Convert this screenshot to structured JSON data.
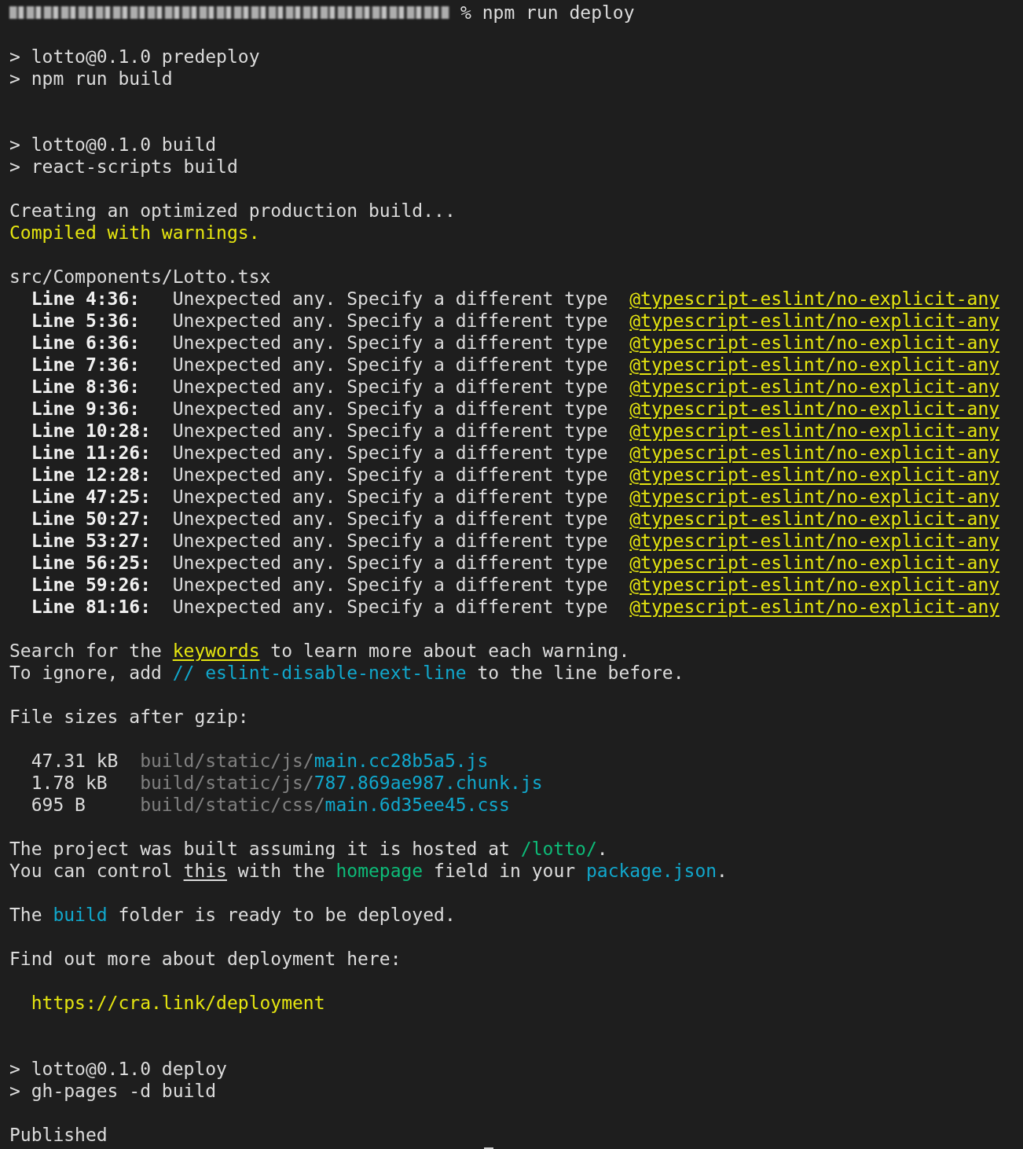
{
  "terminal": {
    "lines": [
      {
        "kind": "prompt",
        "command": "% npm run deploy",
        "cursor": false
      },
      {
        "kind": "blank"
      },
      {
        "kind": "text",
        "segments": [
          {
            "text": "> lotto@0.1.0 predeploy",
            "kind": "plain"
          }
        ]
      },
      {
        "kind": "text",
        "segments": [
          {
            "text": "> npm run build",
            "kind": "plain"
          }
        ]
      },
      {
        "kind": "blank"
      },
      {
        "kind": "blank"
      },
      {
        "kind": "text",
        "segments": [
          {
            "text": "> lotto@0.1.0 build",
            "kind": "plain"
          }
        ]
      },
      {
        "kind": "text",
        "segments": [
          {
            "text": "> react-scripts build",
            "kind": "plain"
          }
        ]
      },
      {
        "kind": "blank"
      },
      {
        "kind": "text",
        "segments": [
          {
            "text": "Creating an optimized production build...",
            "kind": "plain"
          }
        ]
      },
      {
        "kind": "text",
        "segments": [
          {
            "text": "Compiled with warnings.",
            "kind": "yellow"
          }
        ]
      },
      {
        "kind": "blank"
      },
      {
        "kind": "text",
        "segments": [
          {
            "text": "src/Components/Lotto.tsx",
            "kind": "plain"
          }
        ]
      },
      {
        "kind": "lint",
        "location": "Line 4:36:",
        "message": "Unexpected any. Specify a different type",
        "rule": "@typescript-eslint/no-explicit-any"
      },
      {
        "kind": "lint",
        "location": "Line 5:36:",
        "message": "Unexpected any. Specify a different type",
        "rule": "@typescript-eslint/no-explicit-any"
      },
      {
        "kind": "lint",
        "location": "Line 6:36:",
        "message": "Unexpected any. Specify a different type",
        "rule": "@typescript-eslint/no-explicit-any"
      },
      {
        "kind": "lint",
        "location": "Line 7:36:",
        "message": "Unexpected any. Specify a different type",
        "rule": "@typescript-eslint/no-explicit-any"
      },
      {
        "kind": "lint",
        "location": "Line 8:36:",
        "message": "Unexpected any. Specify a different type",
        "rule": "@typescript-eslint/no-explicit-any"
      },
      {
        "kind": "lint",
        "location": "Line 9:36:",
        "message": "Unexpected any. Specify a different type",
        "rule": "@typescript-eslint/no-explicit-any"
      },
      {
        "kind": "lint",
        "location": "Line 10:28:",
        "message": "Unexpected any. Specify a different type",
        "rule": "@typescript-eslint/no-explicit-any"
      },
      {
        "kind": "lint",
        "location": "Line 11:26:",
        "message": "Unexpected any. Specify a different type",
        "rule": "@typescript-eslint/no-explicit-any"
      },
      {
        "kind": "lint",
        "location": "Line 12:28:",
        "message": "Unexpected any. Specify a different type",
        "rule": "@typescript-eslint/no-explicit-any"
      },
      {
        "kind": "lint",
        "location": "Line 47:25:",
        "message": "Unexpected any. Specify a different type",
        "rule": "@typescript-eslint/no-explicit-any"
      },
      {
        "kind": "lint",
        "location": "Line 50:27:",
        "message": "Unexpected any. Specify a different type",
        "rule": "@typescript-eslint/no-explicit-any"
      },
      {
        "kind": "lint",
        "location": "Line 53:27:",
        "message": "Unexpected any. Specify a different type",
        "rule": "@typescript-eslint/no-explicit-any"
      },
      {
        "kind": "lint",
        "location": "Line 56:25:",
        "message": "Unexpected any. Specify a different type",
        "rule": "@typescript-eslint/no-explicit-any"
      },
      {
        "kind": "lint",
        "location": "Line 59:26:",
        "message": "Unexpected any. Specify a different type",
        "rule": "@typescript-eslint/no-explicit-any"
      },
      {
        "kind": "lint",
        "location": "Line 81:16:",
        "message": "Unexpected any. Specify a different type",
        "rule": "@typescript-eslint/no-explicit-any"
      },
      {
        "kind": "blank"
      },
      {
        "kind": "text",
        "segments": [
          {
            "text": "Search for the ",
            "kind": "plain"
          },
          {
            "text": "keywords",
            "kind": "yellow-underline"
          },
          {
            "text": " to learn more about each warning.",
            "kind": "plain"
          }
        ]
      },
      {
        "kind": "text",
        "segments": [
          {
            "text": "To ignore, add ",
            "kind": "plain"
          },
          {
            "text": "// eslint-disable-next-line",
            "kind": "cyan"
          },
          {
            "text": " to the line before.",
            "kind": "plain"
          }
        ]
      },
      {
        "kind": "blank"
      },
      {
        "kind": "text",
        "segments": [
          {
            "text": "File sizes after gzip:",
            "kind": "plain"
          }
        ]
      },
      {
        "kind": "blank"
      },
      {
        "kind": "file",
        "size": "47.31 kB",
        "dir": "build/static/js/",
        "name": "main.cc28b5a5.js"
      },
      {
        "kind": "file",
        "size": "1.78 kB",
        "dir": "build/static/js/",
        "name": "787.869ae987.chunk.js"
      },
      {
        "kind": "file",
        "size": "695 B",
        "dir": "build/static/css/",
        "name": "main.6d35ee45.css"
      },
      {
        "kind": "blank"
      },
      {
        "kind": "text",
        "segments": [
          {
            "text": "The project was built assuming it is hosted at ",
            "kind": "plain"
          },
          {
            "text": "/lotto/",
            "kind": "green"
          },
          {
            "text": ".",
            "kind": "plain"
          }
        ]
      },
      {
        "kind": "text",
        "segments": [
          {
            "text": "You can control ",
            "kind": "plain"
          },
          {
            "text": "this",
            "kind": "underline"
          },
          {
            "text": " with the ",
            "kind": "plain"
          },
          {
            "text": "homepage",
            "kind": "green"
          },
          {
            "text": " field in your ",
            "kind": "plain"
          },
          {
            "text": "package.json",
            "kind": "cyan"
          },
          {
            "text": ".",
            "kind": "plain"
          }
        ]
      },
      {
        "kind": "blank"
      },
      {
        "kind": "text",
        "segments": [
          {
            "text": "The ",
            "kind": "plain"
          },
          {
            "text": "build",
            "kind": "cyan"
          },
          {
            "text": " folder is ready to be deployed.",
            "kind": "plain"
          }
        ]
      },
      {
        "kind": "blank"
      },
      {
        "kind": "text",
        "segments": [
          {
            "text": "Find out more about deployment here:",
            "kind": "plain"
          }
        ]
      },
      {
        "kind": "blank"
      },
      {
        "kind": "url",
        "text": "https://cra.link/deployment"
      },
      {
        "kind": "blank"
      },
      {
        "kind": "blank"
      },
      {
        "kind": "text",
        "segments": [
          {
            "text": "> lotto@0.1.0 deploy",
            "kind": "plain"
          }
        ]
      },
      {
        "kind": "text",
        "segments": [
          {
            "text": "> gh-pages -d build",
            "kind": "plain"
          }
        ]
      },
      {
        "kind": "blank"
      },
      {
        "kind": "text",
        "segments": [
          {
            "text": "Published",
            "kind": "plain"
          }
        ]
      },
      {
        "kind": "prompt",
        "cursor": true
      }
    ]
  }
}
